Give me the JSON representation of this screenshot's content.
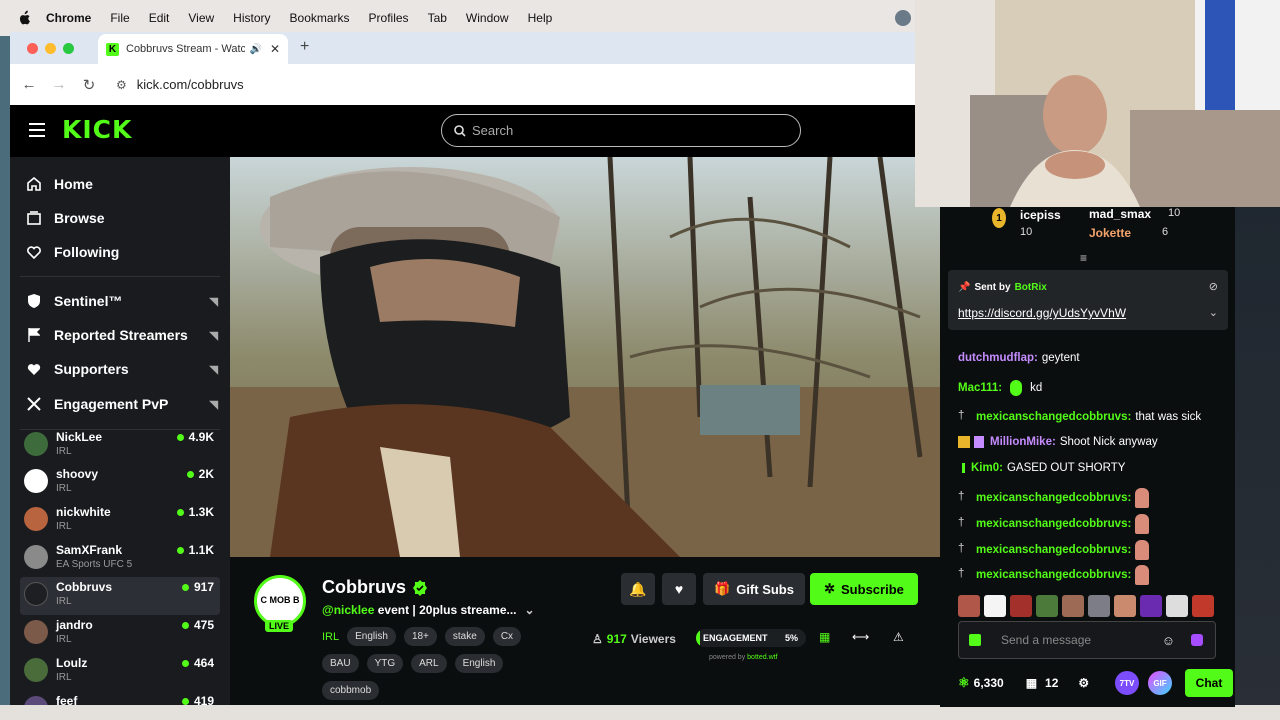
{
  "menubar": {
    "items": [
      "Chrome",
      "File",
      "Edit",
      "View",
      "History",
      "Bookmarks",
      "Profiles",
      "Tab",
      "Window",
      "Help"
    ]
  },
  "browser": {
    "tab_title": "Cobbruvs Stream - Watch",
    "url": "kick.com/cobbruvs"
  },
  "header": {
    "logo": "KICK",
    "search_placeholder": "Search"
  },
  "sidebar": {
    "nav": [
      {
        "label": "Home",
        "icon": "home-icon"
      },
      {
        "label": "Browse",
        "icon": "browse-icon"
      },
      {
        "label": "Following",
        "icon": "heart-icon"
      }
    ],
    "extensions": [
      {
        "label": "Sentinel™",
        "icon": "shield-icon"
      },
      {
        "label": "Reported Streamers",
        "icon": "flag-icon"
      },
      {
        "label": "Supporters",
        "icon": "heart-icon"
      },
      {
        "label": "Engagement PvP",
        "icon": "swords-icon"
      }
    ],
    "channels": [
      {
        "name": "NickLee",
        "category": "IRL",
        "viewers": "4.9K"
      },
      {
        "name": "shoovy",
        "category": "IRL",
        "viewers": "2K"
      },
      {
        "name": "nickwhite",
        "category": "IRL",
        "viewers": "1.3K"
      },
      {
        "name": "SamXFrank",
        "category": "EA Sports UFC 5",
        "viewers": "1.1K"
      },
      {
        "name": "Cobbruvs",
        "category": "IRL",
        "viewers": "917"
      },
      {
        "name": "jandro",
        "category": "IRL",
        "viewers": "475"
      },
      {
        "name": "Loulz",
        "category": "IRL",
        "viewers": "464"
      },
      {
        "name": "feef",
        "category": "",
        "viewers": "419"
      }
    ]
  },
  "stream": {
    "avatar_text": "C MOB B",
    "live": "LIVE",
    "streamer": "Cobbruvs",
    "mention": "@nicklee",
    "title_rest": " event | 20plus streame...",
    "category": "IRL",
    "tags_row1": [
      "English",
      "18+",
      "stake",
      "Cx"
    ],
    "tags_row2": [
      "BAU",
      "YTG",
      "ARL",
      "English"
    ],
    "tags_row3": [
      "cobbmob"
    ],
    "gift_label": "Gift Subs",
    "subscribe_label": "Subscribe",
    "viewers": "917",
    "viewers_label": "Viewers",
    "engagement_label": "ENGAGEMENT",
    "engagement_pct": "5%",
    "engagement_fraction": 0.05,
    "powered_prefix": "powered by",
    "powered_brand": "botted.wtf"
  },
  "chat": {
    "leaderboard": [
      {
        "rank": "1",
        "name": "icepiss",
        "count": "10"
      },
      {
        "name": "mad_smax",
        "count": "10"
      },
      {
        "name": "Jokette",
        "count": "6"
      }
    ],
    "pinned": {
      "sent_by": "Sent by",
      "bot": "BotRix",
      "link": "https://discord.gg/yUdsYyvVhW"
    },
    "messages": [
      {
        "user": "dutchmudflap:",
        "text": "geytent"
      },
      {
        "user": "Mac111:",
        "text": "kd"
      },
      {
        "user": "mexicanschangedcobbruvs:",
        "text": "that was sick"
      },
      {
        "user": "MillionMike:",
        "text": "Shoot Nick anyway"
      },
      {
        "user": "Kim0:",
        "text": "GASED OUT SHORTY"
      },
      {
        "user": "mexicanschangedcobbruvs:",
        "text": ""
      },
      {
        "user": "mexicanschangedcobbruvs:",
        "text": ""
      },
      {
        "user": "mexicanschangedcobbruvs:",
        "text": ""
      },
      {
        "user": "mexicanschangedcobbruvs:",
        "text": ""
      }
    ],
    "input_placeholder": "Send a message",
    "points": "6,330",
    "gifts": "12",
    "ext_7tv": "7TV",
    "ext_gif": "GIF",
    "chat_button": "Chat"
  },
  "colors": {
    "accent": "#53fc18",
    "background": "#0b0e0f",
    "sidebar": "#191b1f"
  }
}
